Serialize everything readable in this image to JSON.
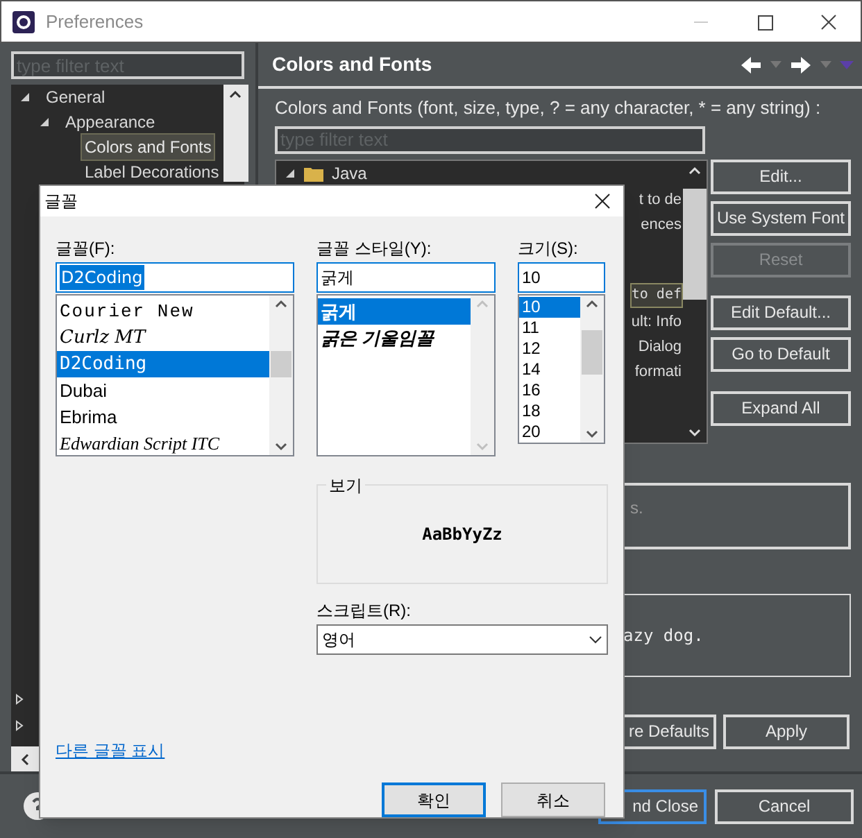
{
  "window": {
    "title": "Preferences"
  },
  "nav": {
    "filter": {
      "placeholder": "type filter text"
    },
    "tree": [
      {
        "label": "General",
        "expanded": true,
        "children": [
          {
            "label": "Appearance",
            "expanded": true,
            "children": [
              {
                "label": "Colors and Fonts",
                "selected": true
              },
              {
                "label": "Label Decorations",
                "selected": false
              }
            ]
          }
        ]
      }
    ],
    "unlabeled_rows": [
      {
        "expanded": false
      },
      {
        "expanded": false
      }
    ]
  },
  "page": {
    "title": "Colors and Fonts",
    "description": "Colors and Fonts (font, size, type, ? = any character, * = any string) :",
    "filter": {
      "placeholder": "type filter text"
    },
    "tree_root": {
      "label": "Java",
      "expanded": true
    },
    "tree_rows": [
      {
        "kind": "line",
        "text": "t to de",
        "selected": false
      },
      {
        "kind": "line",
        "text": "ences",
        "selected": false
      },
      {
        "kind": "code",
        "text": "to def",
        "selected": true
      },
      {
        "kind": "line",
        "text": "ult: Info",
        "selected": false
      },
      {
        "kind": "line",
        "text": "Dialog",
        "selected": false
      },
      {
        "kind": "line",
        "text": "formati",
        "selected": false
      }
    ],
    "buttons": [
      {
        "label": "Edit...",
        "disabled": false
      },
      {
        "label": "Use System Font",
        "disabled": false
      },
      {
        "label": "Reset",
        "disabled": true
      },
      {
        "label": "Edit Default...",
        "disabled": false
      },
      {
        "label": "Go to Default",
        "disabled": false
      },
      {
        "label": "Expand All",
        "disabled": false
      }
    ],
    "description_box": "s.",
    "preview_box": "azy dog.",
    "footer_buttons": [
      {
        "label": "re Defaults"
      },
      {
        "label": "Apply"
      }
    ]
  },
  "bottom_buttons": [
    {
      "label": "nd Close",
      "default": true
    },
    {
      "label": "Cancel",
      "default": false
    }
  ],
  "font_dialog": {
    "title": "글꼴",
    "font": {
      "label": "글꼴(F):",
      "value": "D2Coding",
      "items": [
        {
          "label": "Courier New",
          "kind": "mono",
          "selected": false
        },
        {
          "label": "Curlz MT",
          "kind": "decorative",
          "selected": false
        },
        {
          "label": "D2Coding",
          "kind": "code",
          "selected": true
        },
        {
          "label": "Dubai",
          "kind": "sans",
          "selected": false
        },
        {
          "label": "Ebrima",
          "kind": "sans",
          "selected": false
        },
        {
          "label": "Edwardian Script ITC",
          "kind": "script",
          "selected": false
        }
      ]
    },
    "style": {
      "label": "글꼴 스타일(Y):",
      "value": "굵게",
      "items": [
        {
          "label": "굵게",
          "kind": "bold",
          "selected": true
        },
        {
          "label": "굵은 기울임꼴",
          "kind": "bold_italic",
          "selected": false
        }
      ]
    },
    "size": {
      "label": "크기(S):",
      "value": "10",
      "items": [
        {
          "label": "10",
          "selected": true
        },
        {
          "label": "11",
          "selected": false
        },
        {
          "label": "12",
          "selected": false
        },
        {
          "label": "14",
          "selected": false
        },
        {
          "label": "16",
          "selected": false
        },
        {
          "label": "18",
          "selected": false
        },
        {
          "label": "20",
          "selected": false
        }
      ]
    },
    "preview": {
      "label": "보기",
      "sample": "AaBbYyZz"
    },
    "script": {
      "label": "스크립트(R):",
      "value": "영어"
    },
    "link": "다른 글꼴 표시",
    "buttons": [
      {
        "label": "확인",
        "default": true
      },
      {
        "label": "취소",
        "default": false
      }
    ]
  }
}
